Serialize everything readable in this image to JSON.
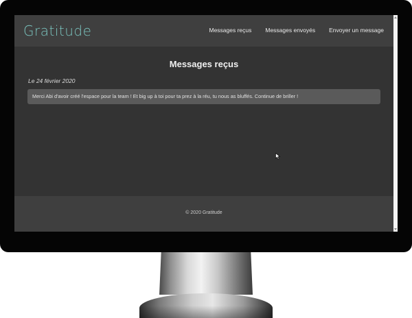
{
  "app": {
    "brand": "Gratitude"
  },
  "nav": {
    "items": [
      {
        "label": "Messages reçus"
      },
      {
        "label": "Messages envoyés"
      },
      {
        "label": "Envoyer un message"
      }
    ]
  },
  "main": {
    "title": "Messages reçus",
    "messages": [
      {
        "date": "Le 24 février 2020",
        "text": "Merci Abi d'avoir créé l'espace pour la team ! Et big up à toi pour ta prez à la réu, tu nous as bluffés. Continue de briller !"
      }
    ]
  },
  "footer": {
    "text": "© 2020 Gratitude"
  },
  "colors": {
    "brand": "#7bc4bf",
    "background": "#333333",
    "nav_background": "#3f3f3f",
    "card_background": "#5a5a5a"
  },
  "icons": {
    "cursor": "mouse-cursor-icon"
  }
}
